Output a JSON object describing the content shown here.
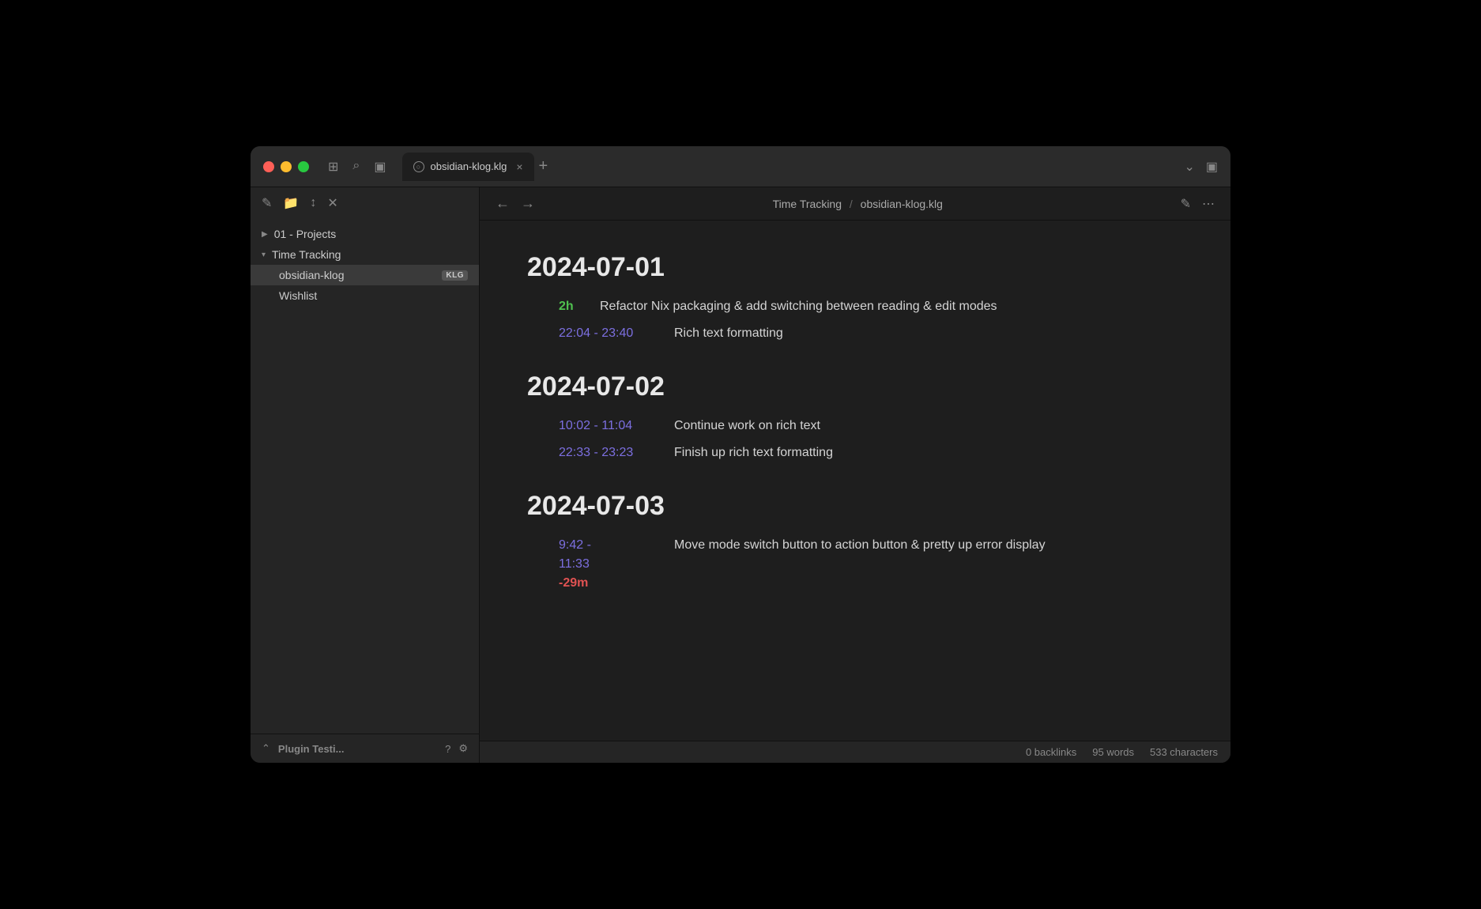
{
  "window": {
    "title": "obsidian-klog.klg"
  },
  "titlebar": {
    "tab_label": "obsidian-klog.klg",
    "tab_new_label": "+",
    "tab_close_label": "×"
  },
  "sidebar": {
    "toolbar_icons": [
      "new-note",
      "new-folder",
      "sort",
      "close"
    ],
    "items": [
      {
        "id": "projects",
        "label": "01 - Projects",
        "indent": 0,
        "chevron": "▶",
        "expanded": false
      },
      {
        "id": "time-tracking",
        "label": "Time Tracking",
        "indent": 0,
        "chevron": "▾",
        "expanded": true
      },
      {
        "id": "obsidian-klog",
        "label": "obsidian-klog",
        "indent": 1,
        "badge": "KLG",
        "active": true
      },
      {
        "id": "wishlist",
        "label": "Wishlist",
        "indent": 1
      }
    ],
    "footer": {
      "label": "Plugin Testi...",
      "chevron": "⌃"
    }
  },
  "editor": {
    "breadcrumb": {
      "folder": "Time Tracking",
      "file": "obsidian-klog.klg",
      "separator": "/"
    },
    "sections": [
      {
        "date": "2024-07-01",
        "entries": [
          {
            "type": "duration",
            "time": "2h",
            "desc": " Refactor Nix packaging & add switching between reading & edit modes"
          },
          {
            "type": "range",
            "time": "22:04 - 23:40",
            "desc": "Rich text formatting"
          }
        ]
      },
      {
        "date": "2024-07-02",
        "entries": [
          {
            "type": "range",
            "time": "10:02 - 11:04",
            "desc": "Continue work on rich text"
          },
          {
            "type": "range",
            "time": "22:33 - 23:23",
            "desc": "Finish up rich text formatting"
          }
        ]
      },
      {
        "date": "2024-07-03",
        "entries": [
          {
            "type": "open-range",
            "time_line1": "9:42 -",
            "time_line2": "11:33",
            "negative": "-29m",
            "desc": "Move mode switch button to action button & pretty up error display"
          }
        ]
      }
    ],
    "status": {
      "backlinks": "0 backlinks",
      "words": "95 words",
      "chars": "533 characters"
    }
  }
}
